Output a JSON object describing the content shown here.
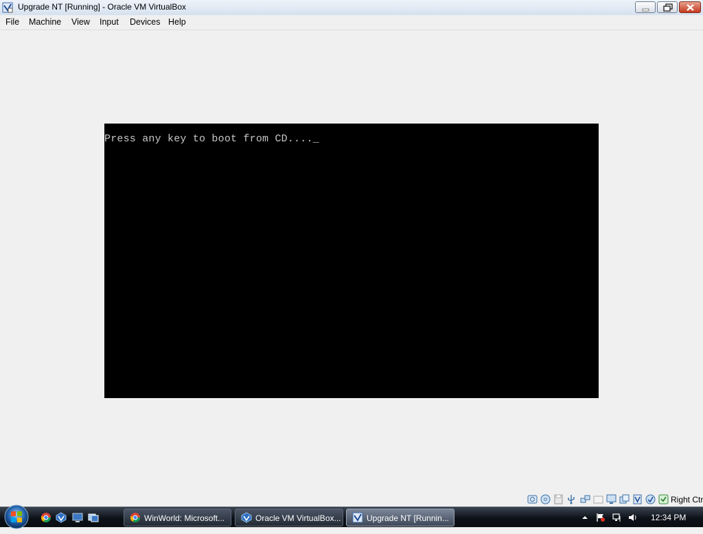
{
  "window": {
    "title": "Upgrade NT [Running] - Oracle VM VirtualBox",
    "app_icon": "virtualbox-vm-icon",
    "controls": [
      "minimize-icon",
      "restore-icon",
      "close-icon"
    ]
  },
  "menubar": {
    "items": [
      "File",
      "Machine",
      "View",
      "Input",
      "Devices",
      "Help"
    ]
  },
  "vm_screen": {
    "console_text": "Press any key to boot from CD....",
    "cursor": "_",
    "background": "#000000",
    "text_color": "#c8c8c8"
  },
  "statusbar": {
    "icons": [
      "hard-disk-icon",
      "optical-drive-icon",
      "floppy-icon",
      "usb-icon",
      "network-icon",
      "shared-folders-icon",
      "display-icon",
      "video-capture-icon",
      "virtualization-icon",
      "mouse-integration-icon",
      "keyboard-capture-icon"
    ],
    "host_key": "Right Ctrl"
  },
  "taskbar": {
    "start_icon": "windows-start-orb-icon",
    "quick_launch": [
      "chrome-icon",
      "virtualbox-icon",
      "desktop-icon",
      "window-switch-icon"
    ],
    "buttons": [
      {
        "label": "WinWorld: Microsoft...",
        "icon": "chrome-icon",
        "active": false
      },
      {
        "label": "Oracle VM VirtualBox...",
        "icon": "virtualbox-icon",
        "active": false
      },
      {
        "label": "Upgrade NT [Runnin...",
        "icon": "virtualbox-vm-icon",
        "active": true
      }
    ],
    "tray_icons": [
      "show-hidden-icons-arrow",
      "action-center-flag-icon",
      "network-icon",
      "volume-icon"
    ],
    "clock": "12:34 PM"
  },
  "colors": {
    "taskbar": "#0d1218",
    "window_bg": "#f0f0f0",
    "close_button": "#c4391d"
  }
}
